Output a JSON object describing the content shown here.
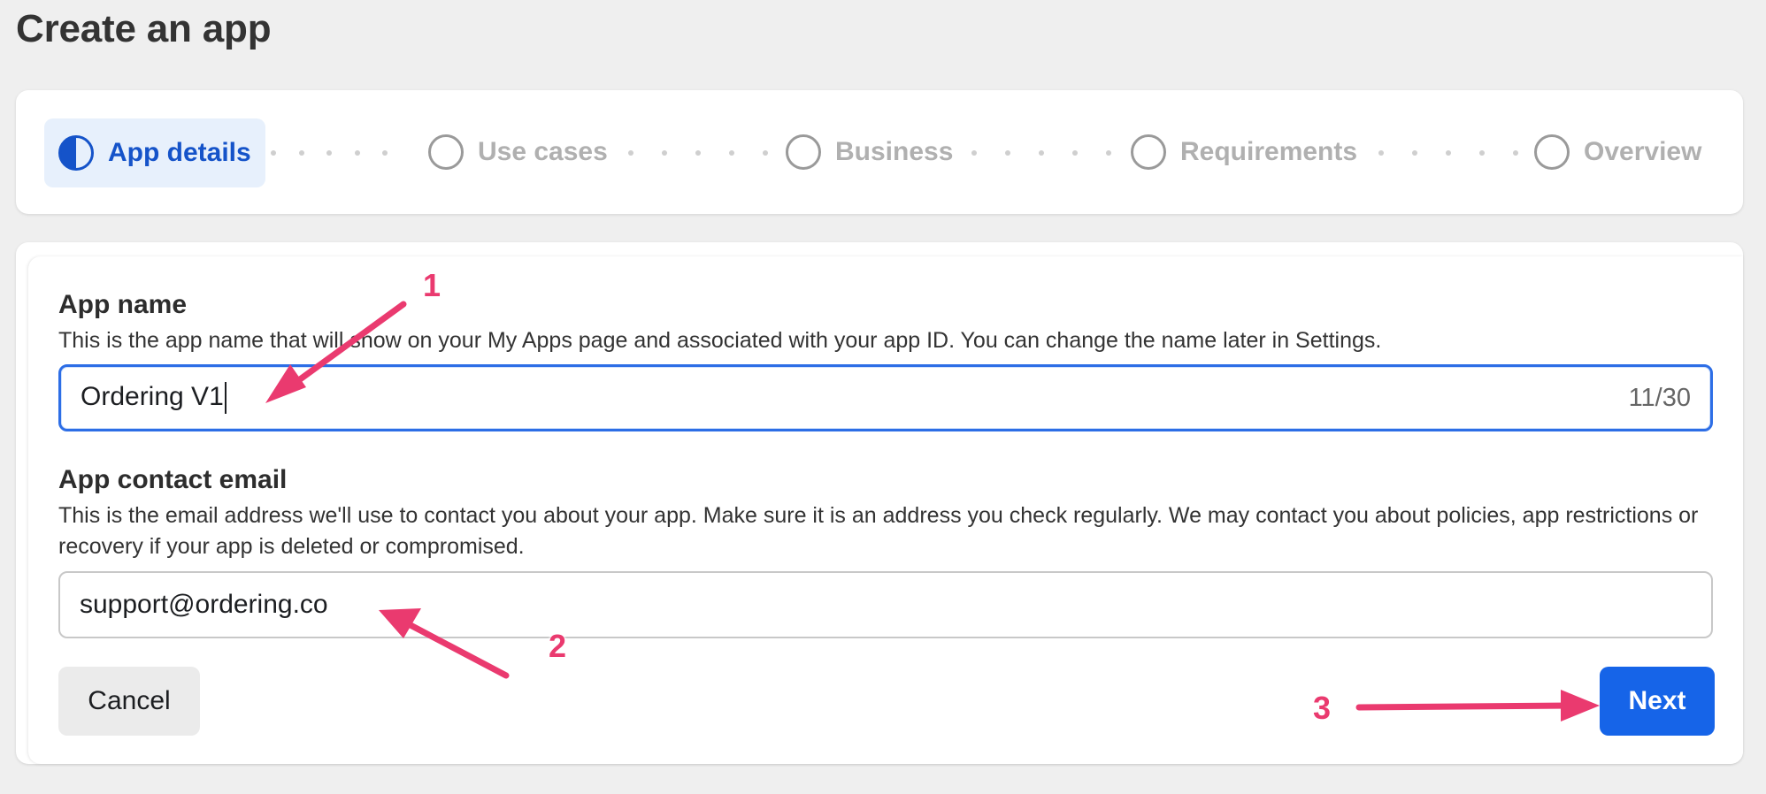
{
  "page": {
    "title": "Create an app"
  },
  "stepper": {
    "steps": [
      {
        "label": "App details",
        "state": "active"
      },
      {
        "label": "Use cases",
        "state": "pending"
      },
      {
        "label": "Business",
        "state": "pending"
      },
      {
        "label": "Requirements",
        "state": "pending"
      },
      {
        "label": "Overview",
        "state": "pending"
      }
    ]
  },
  "form": {
    "app_name": {
      "label": "App name",
      "description": "This is the app name that will show on your My Apps page and associated with your app ID. You can change the name later in Settings.",
      "value": "Ordering V1",
      "counter": "11/30"
    },
    "contact_email": {
      "label": "App contact email",
      "description": "This is the email address we'll use to contact you about your app. Make sure it is an address you check regularly. We may contact you about policies, app restrictions or recovery if your app is deleted or compromised.",
      "value": "support@ordering.co"
    },
    "cancel_label": "Cancel",
    "next_label": "Next"
  },
  "annotations": {
    "color": "#ea3a6f",
    "markers": [
      "1",
      "2",
      "3"
    ]
  },
  "colors": {
    "accent": "#1664e8",
    "active_step_bg": "#e7f0fc",
    "active_step_text": "#1553c9"
  }
}
